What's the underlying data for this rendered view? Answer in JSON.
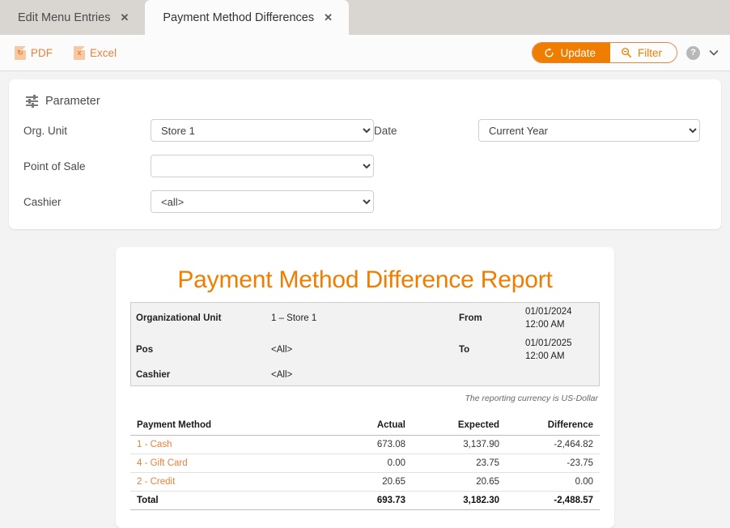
{
  "tabs": [
    {
      "label": "Edit Menu Entries",
      "active": false,
      "close_icon": "✕"
    },
    {
      "label": "Payment Method Differences",
      "active": true,
      "close_icon": "✕"
    }
  ],
  "toolbar": {
    "pdf_label": "PDF",
    "pdf_icon_letter": "⚗",
    "excel_label": "Excel",
    "excel_icon_letter": "x",
    "update_label": "Update",
    "filter_label": "Filter",
    "help_label": "?",
    "chevron": "⌄",
    "accent_color": "#ef7d00"
  },
  "parameter": {
    "section_title": "Parameter",
    "fields": [
      {
        "label": "Org. Unit",
        "value": "Store 1"
      },
      {
        "label": "Date",
        "value": "Current Year"
      },
      {
        "label": "Point of Sale",
        "value": ""
      },
      {
        "label": "Cashier",
        "value": "<all>"
      }
    ]
  },
  "report": {
    "title": "Payment Method Difference Report",
    "meta": [
      {
        "key": "Organizational Unit",
        "value": "1 – Store 1",
        "key2": "From",
        "value2": "01/01/2024 12:00 AM"
      },
      {
        "key": "Pos",
        "value": "<All>",
        "key2": "To",
        "value2": "01/01/2025 12:00 AM"
      },
      {
        "key": "Cashier",
        "value": "<All>",
        "key2": "",
        "value2": ""
      }
    ],
    "currency_note": "The reporting currency is US-Dollar",
    "table": {
      "headers": [
        "Payment Method",
        "Actual",
        "Expected",
        "Difference"
      ],
      "rows": [
        {
          "method": "1 - Cash",
          "actual": "673.08",
          "expected": "3,137.90",
          "difference": "-2,464.82"
        },
        {
          "method": "4 - Gift Card",
          "actual": "0.00",
          "expected": "23.75",
          "difference": "-23.75"
        },
        {
          "method": "2 - Credit",
          "actual": "20.65",
          "expected": "20.65",
          "difference": "0.00"
        }
      ],
      "total": {
        "method": "Total",
        "actual": "693.73",
        "expected": "3,182.30",
        "difference": "-2,488.57"
      }
    }
  }
}
